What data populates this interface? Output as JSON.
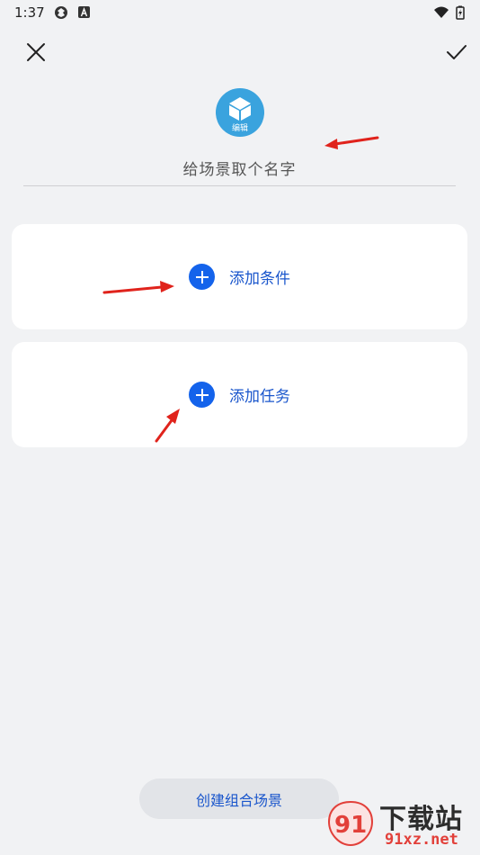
{
  "status_bar": {
    "time": "1:37",
    "icons": [
      "app-icon",
      "a-badge-icon",
      "wifi-icon",
      "battery-icon"
    ]
  },
  "toolbar": {
    "close_icon": "close-icon",
    "confirm_icon": "check-icon"
  },
  "scene": {
    "avatar_label": "编辑",
    "name_placeholder": "给场景取个名字"
  },
  "cards": {
    "add_condition": "添加条件",
    "add_task": "添加任务"
  },
  "footer": {
    "create_button": "创建组合场景"
  },
  "watermark": {
    "title": "下载站",
    "url": "91xz.net"
  },
  "colors": {
    "accent": "#1463eb",
    "background": "#f1f2f4",
    "annotation_arrow": "#e0231c"
  }
}
